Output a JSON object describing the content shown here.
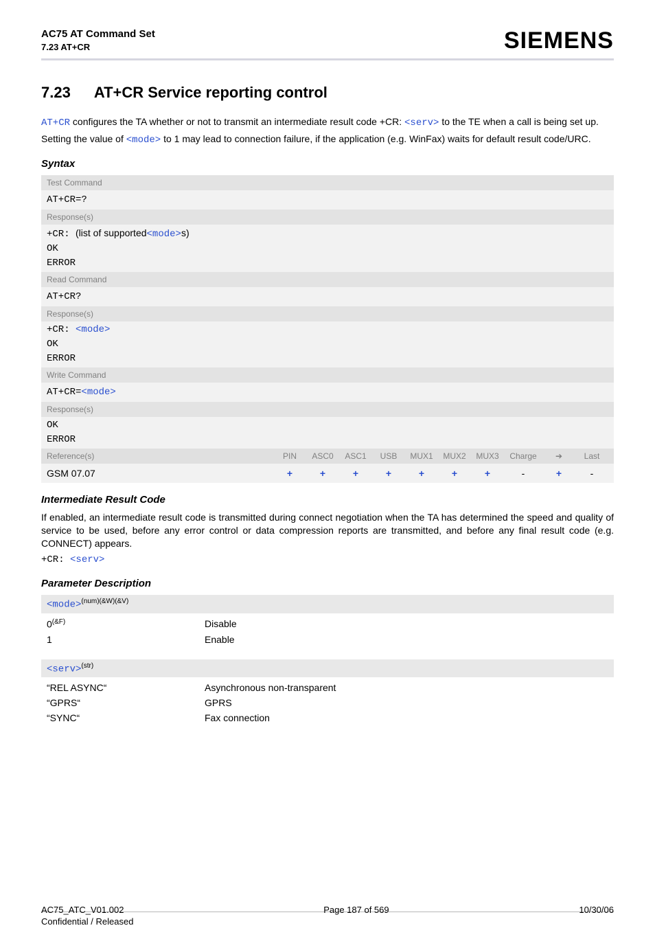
{
  "header": {
    "product": "AC75 AT Command Set",
    "subsection": "7.23 AT+CR",
    "logo": "SIEMENS"
  },
  "title": {
    "number": "7.23",
    "text": "AT+CR   Service reporting control"
  },
  "intro": {
    "l1a": "AT+CR",
    "l1b": " configures the TA whether or not to transmit an intermediate result code +CR: ",
    "l1c": "<serv>",
    "l1d": " to the TE when a call is being set up.",
    "l2a": "Setting the value of ",
    "l2b": "<mode>",
    "l2c": " to 1 may lead to connection failure, if the application (e.g. WinFax) waits for default result code/URC."
  },
  "sub_syntax": "Syntax",
  "syntax": {
    "test_label": "Test Command",
    "test_cmd": "AT+CR=?",
    "resp_label": "Response(s)",
    "test_r1a": "+CR: ",
    "test_r1b": "(list of supported",
    "test_r1c": "<mode>",
    "test_r1d": "s)",
    "ok": "OK",
    "error": "ERROR",
    "read_label": "Read Command",
    "read_cmd": "AT+CR?",
    "read_r1a": "+CR: ",
    "read_r1b": "<mode>",
    "write_label": "Write Command",
    "write_cmd_a": "AT+CR=",
    "write_cmd_b": "<mode>",
    "ref_label": "Reference(s)",
    "cols": [
      "PIN",
      "ASC0",
      "ASC1",
      "USB",
      "MUX1",
      "MUX2",
      "MUX3",
      "Charge",
      "➔",
      "Last"
    ],
    "gsm": "GSM 07.07",
    "vals": [
      "+",
      "+",
      "+",
      "+",
      "+",
      "+",
      "+",
      "-",
      "+",
      "-"
    ]
  },
  "sub_irc": "Intermediate Result Code",
  "irc_text": "If enabled, an intermediate result code is transmitted during connect negotiation when the TA has determined the speed and quality of service to be used, before any error control or data compression reports are transmitted, and before any final result code (e.g. CONNECT) appears.",
  "irc_code_a": "+CR: ",
  "irc_code_b": "<serv>",
  "sub_param": "Parameter Description",
  "param_mode": {
    "name": "<mode>",
    "sup": "(num)(&W)(&V)",
    "rows": [
      {
        "k": "0",
        "ksup": "(&F)",
        "v": "Disable"
      },
      {
        "k": "1",
        "ksup": "",
        "v": "Enable"
      }
    ]
  },
  "param_serv": {
    "name": "<serv>",
    "sup": "(str)",
    "rows": [
      {
        "k": "“REL ASYNC“",
        "v": "Asynchronous non-transparent"
      },
      {
        "k": "“GPRS“",
        "v": "GPRS"
      },
      {
        "k": "“SYNC“",
        "v": "Fax connection"
      }
    ]
  },
  "footer": {
    "leftA": "AC75_ATC_V01.002",
    "leftB": "Confidential / Released",
    "center": "Page 187 of 569",
    "right": "10/30/06"
  }
}
